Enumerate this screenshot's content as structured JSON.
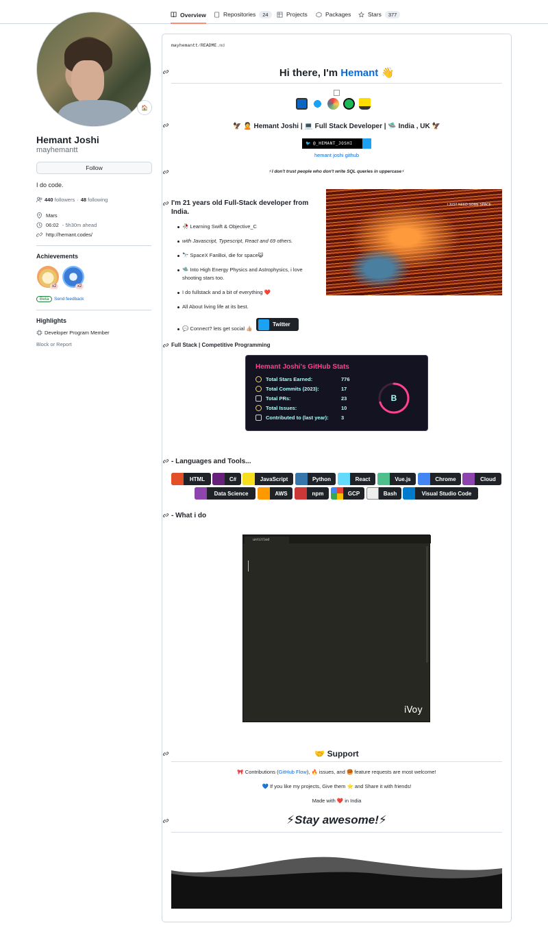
{
  "nav": {
    "tabs": [
      {
        "label": "Overview",
        "count": ""
      },
      {
        "label": "Repositories",
        "count": "24"
      },
      {
        "label": "Projects",
        "count": ""
      },
      {
        "label": "Packages",
        "count": ""
      },
      {
        "label": "Stars",
        "count": "377"
      }
    ]
  },
  "profile": {
    "name": "Hemant Joshi",
    "login": "mayhemantt",
    "follow_label": "Follow",
    "bio": "I do code.",
    "followers_count": "440",
    "followers_label": "followers",
    "following_count": "48",
    "following_label": "following",
    "location": "Mars",
    "local_time": "06:02",
    "time_offset": "- 5h30m ahead",
    "website": "http://hemant.codes/",
    "status_emoji": "🏠"
  },
  "achievements": {
    "title": "Achievements",
    "items": [
      {
        "multiplier": "x2"
      },
      {
        "multiplier": "x2"
      }
    ],
    "beta_label": "Beta",
    "feedback_label": "Send feedback"
  },
  "highlights": {
    "title": "Highlights",
    "item": "Developer Program Member",
    "block_label": "Block or Report"
  },
  "readme": {
    "path_user": "mayhemantt",
    "path_sep": "/",
    "path_file": "README",
    "path_ext": ".md",
    "greeting_prefix": "Hi there, I'm ",
    "greeting_name": "Hemant",
    "greeting_emoji": "👋",
    "tagline": "🦅 🙎 Hemant Joshi | 💻 Full Stack Developer | 🛸 India , UK 🦅",
    "twitter_handle": "@_HEMANT_JOSHI",
    "github_alt": "hemant joshi github",
    "quote": "⚡I don't trust people who don't write SQL queries in uppercase⚡",
    "about_heading": "I'm 21 years old Full-Stack developer from India.",
    "space_caption": "I JUST NEED SOME SPACE",
    "bullets": [
      "🥀 Learning Swift & Objective_C",
      "with Javascript, Typescript, React and 69 others.",
      "🔭 SpaceX FanBoi, die for space😺",
      "🛸 Into High Energy Physics and Astrophysics, i love shooting stars too.",
      "I do fullstack and a bit of everything ❤️",
      "All About living life at its best.",
      "💬 Connect? lets get social 👍🏼"
    ],
    "twitter_button": "Twitter",
    "fullstack_heading": "Full Stack | Competitive Programming",
    "languages_heading": "- Languages and Tools...",
    "whatido_heading": "- What i do",
    "editor_tab": "untitled",
    "editor_brand": "iVoy",
    "support_heading": "🤝 Support",
    "contrib_pre": "🎀 Contributions (",
    "contrib_link": "GitHub Flow",
    "contrib_post": "), 🔥 issues, and 🥮 feature requests are most welcome!",
    "like_line": "💙 If you like my projects, Give them ⭐ and Share it with friends!",
    "made_line": "Made with ❤️ in India",
    "stay_awesome": "⚡Stay awesome!⚡"
  },
  "stats": {
    "title": "Hemant Joshi's GitHub Stats",
    "rows": [
      {
        "label": "Total Stars Earned:",
        "value": "776"
      },
      {
        "label": "Total Commits (2023):",
        "value": "17"
      },
      {
        "label": "Total PRs:",
        "value": "23"
      },
      {
        "label": "Total Issues:",
        "value": "10"
      },
      {
        "label": "Contributed to (last year):",
        "value": "3"
      }
    ],
    "rank": "B",
    "rank_progress": 0.7,
    "colors": {
      "title": "#fe428e",
      "text": "#a9fef7",
      "icon": "#f8d847",
      "bg": "#141321"
    }
  },
  "skills": [
    {
      "label": "HTML",
      "color": "#e34f26"
    },
    {
      "label": "C#",
      "color": "#68217a"
    },
    {
      "label": "JavaScript",
      "color": "#f7df1e"
    },
    {
      "label": "Python",
      "color": "#3776ab"
    },
    {
      "label": "React",
      "color": "#20232a"
    },
    {
      "label": "Vue.js",
      "color": "#4fc08d"
    },
    {
      "label": "Chrome",
      "color": "#4285f4"
    },
    {
      "label": "Cloud",
      "color": "#8e44ad"
    },
    {
      "label": "Data Science",
      "color": "#8e44ad"
    },
    {
      "label": "AWS",
      "color": "#ff9900"
    },
    {
      "label": "npm",
      "color": "#cb3837"
    },
    {
      "label": "GCP",
      "color": "#ffffff"
    },
    {
      "label": "Bash",
      "color": "#ffffff"
    },
    {
      "label": "Visual Studio Code",
      "color": "#007acc"
    }
  ]
}
